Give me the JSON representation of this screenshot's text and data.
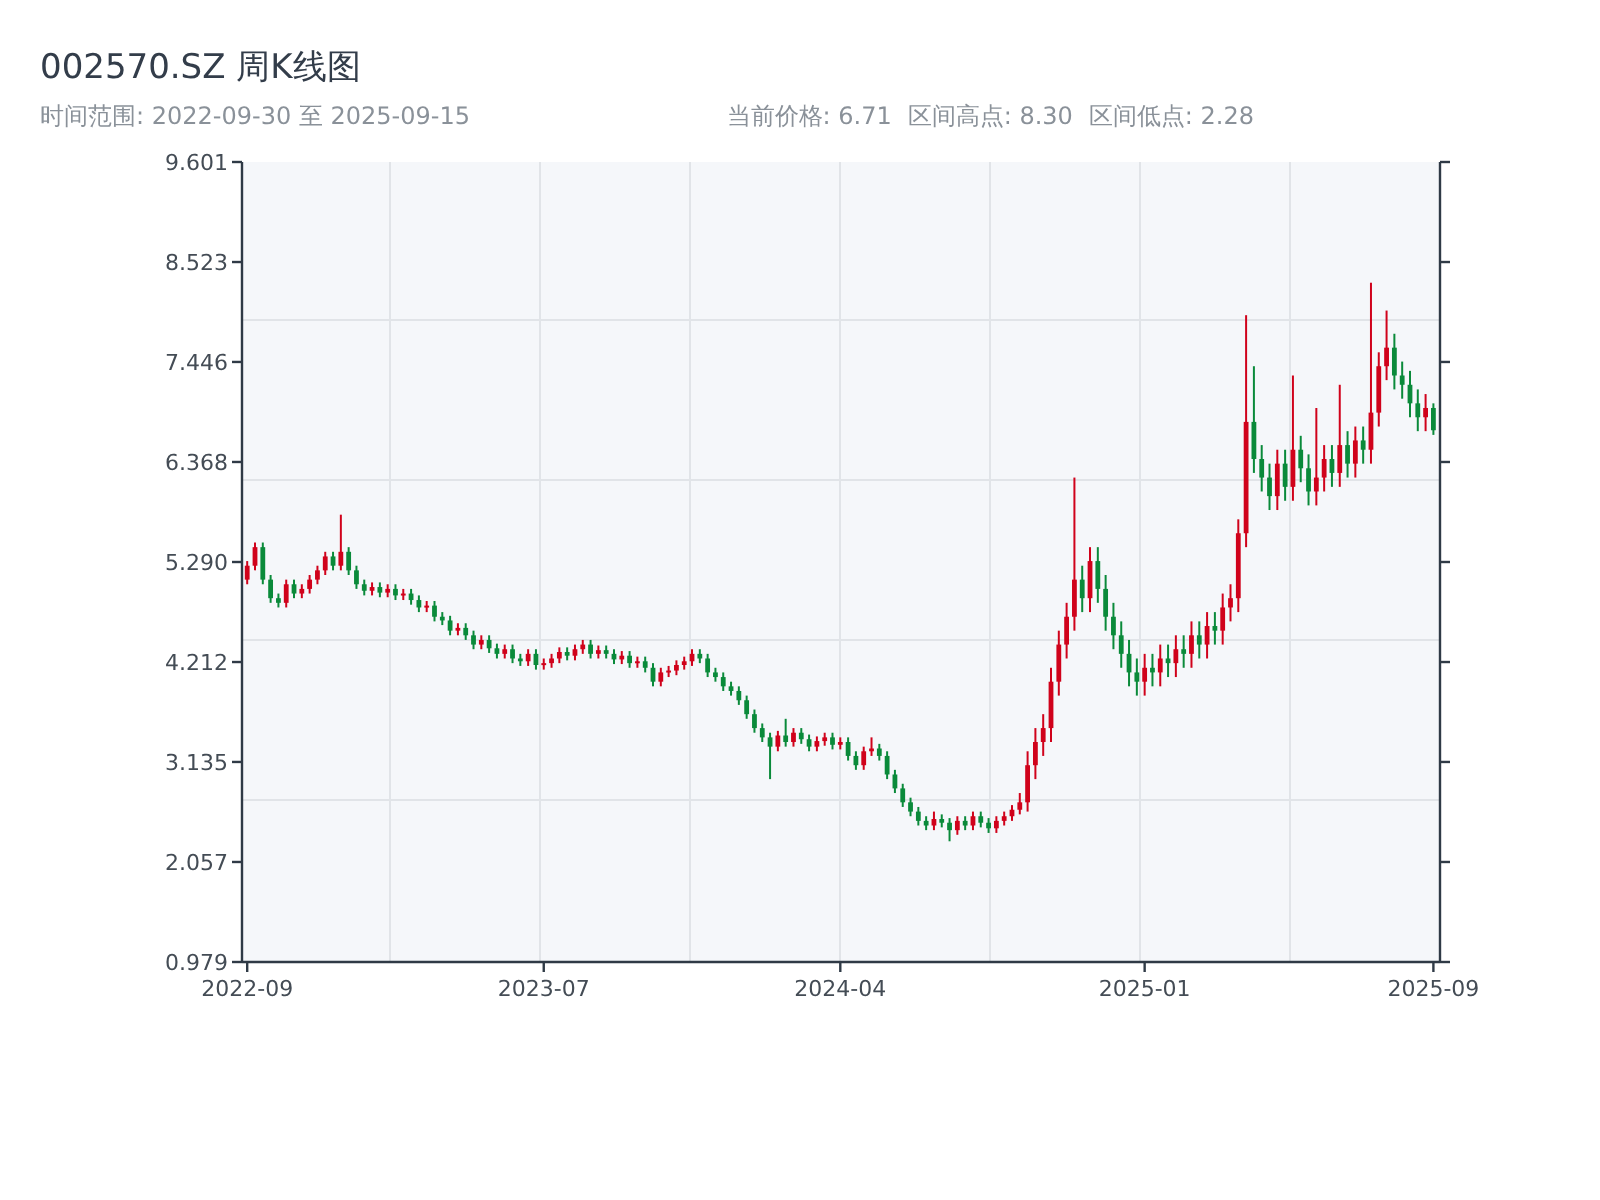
{
  "title": "002570.SZ 周K线图",
  "date_range": "时间范围: 2022-09-30 至 2025-09-15",
  "stats": [
    "当前价格: 6.71",
    "区间高点: 8.30",
    "区间低点: 2.28"
  ],
  "chart": {
    "chart_data": {
      "type": "candlestick",
      "categories": [
        "2022-09",
        null,
        null,
        null,
        null,
        null,
        null,
        null,
        null,
        null,
        null,
        null,
        null,
        null,
        null,
        null,
        null,
        null,
        null,
        null,
        null,
        null,
        null,
        null,
        null,
        null,
        null,
        null,
        null,
        null,
        null,
        null,
        null,
        null,
        null,
        null,
        null,
        null,
        "2023-07",
        null,
        null,
        null,
        null,
        null,
        null,
        null,
        null,
        null,
        null,
        null,
        null,
        null,
        null,
        null,
        null,
        null,
        null,
        null,
        null,
        null,
        null,
        null,
        null,
        null,
        null,
        null,
        null,
        null,
        null,
        null,
        null,
        null,
        null,
        null,
        null,
        null,
        "2024-04",
        null,
        null,
        null,
        null,
        null,
        null,
        null,
        null,
        null,
        null,
        null,
        null,
        null,
        null,
        null,
        null,
        null,
        null,
        null,
        null,
        null,
        null,
        null,
        null,
        null,
        null,
        null,
        null,
        null,
        null,
        null,
        null,
        null,
        null,
        null,
        null,
        null,
        null,
        "2025-01",
        null,
        null,
        null,
        null,
        null,
        null,
        null,
        null,
        null,
        null,
        null,
        null,
        null,
        null,
        null,
        null,
        null,
        null,
        null,
        null,
        null,
        null,
        null,
        null,
        null,
        null,
        null,
        null,
        null,
        null,
        null,
        null,
        null,
        null,
        null,
        null,
        "2025-09"
      ],
      "ohlc": [
        [
          5.1,
          5.3,
          5.05,
          5.25
        ],
        [
          5.25,
          5.5,
          5.2,
          5.45
        ],
        [
          5.45,
          5.5,
          5.05,
          5.1
        ],
        [
          5.1,
          5.15,
          4.85,
          4.9
        ],
        [
          4.9,
          4.95,
          4.8,
          4.85
        ],
        [
          4.85,
          5.1,
          4.8,
          5.05
        ],
        [
          5.05,
          5.1,
          4.9,
          4.95
        ],
        [
          4.95,
          5.05,
          4.9,
          5.0
        ],
        [
          5.0,
          5.15,
          4.95,
          5.1
        ],
        [
          5.1,
          5.25,
          5.05,
          5.2
        ],
        [
          5.2,
          5.4,
          5.15,
          5.35
        ],
        [
          5.35,
          5.4,
          5.2,
          5.25
        ],
        [
          5.25,
          5.8,
          5.2,
          5.4
        ],
        [
          5.4,
          5.45,
          5.15,
          5.2
        ],
        [
          5.2,
          5.25,
          5.0,
          5.05
        ],
        [
          5.05,
          5.1,
          4.93,
          4.98
        ],
        [
          4.98,
          5.07,
          4.93,
          5.02
        ],
        [
          5.02,
          5.07,
          4.91,
          4.96
        ],
        [
          4.96,
          5.05,
          4.91,
          5.0
        ],
        [
          5.0,
          5.05,
          4.88,
          4.93
        ],
        [
          4.93,
          5.0,
          4.88,
          4.95
        ],
        [
          4.95,
          5.0,
          4.83,
          4.88
        ],
        [
          4.88,
          4.93,
          4.75,
          4.8
        ],
        [
          4.8,
          4.87,
          4.75,
          4.82
        ],
        [
          4.82,
          4.87,
          4.65,
          4.7
        ],
        [
          4.7,
          4.75,
          4.61,
          4.66
        ],
        [
          4.66,
          4.71,
          4.5,
          4.55
        ],
        [
          4.55,
          4.63,
          4.5,
          4.58
        ],
        [
          4.58,
          4.63,
          4.45,
          4.5
        ],
        [
          4.5,
          4.55,
          4.35,
          4.4
        ],
        [
          4.4,
          4.5,
          4.35,
          4.45
        ],
        [
          4.45,
          4.5,
          4.31,
          4.36
        ],
        [
          4.36,
          4.41,
          4.25,
          4.3
        ],
        [
          4.3,
          4.4,
          4.25,
          4.35
        ],
        [
          4.35,
          4.4,
          4.2,
          4.25
        ],
        [
          4.25,
          4.3,
          4.17,
          4.22
        ],
        [
          4.22,
          4.35,
          4.17,
          4.3
        ],
        [
          4.3,
          4.35,
          4.13,
          4.18
        ],
        [
          4.18,
          4.25,
          4.13,
          4.2
        ],
        [
          4.2,
          4.3,
          4.15,
          4.25
        ],
        [
          4.25,
          4.37,
          4.2,
          4.32
        ],
        [
          4.32,
          4.37,
          4.23,
          4.28
        ],
        [
          4.28,
          4.4,
          4.23,
          4.35
        ],
        [
          4.35,
          4.45,
          4.3,
          4.4
        ],
        [
          4.4,
          4.45,
          4.25,
          4.3
        ],
        [
          4.3,
          4.39,
          4.25,
          4.34
        ],
        [
          4.34,
          4.39,
          4.25,
          4.3
        ],
        [
          4.3,
          4.35,
          4.19,
          4.24
        ],
        [
          4.24,
          4.33,
          4.19,
          4.28
        ],
        [
          4.28,
          4.33,
          4.15,
          4.2
        ],
        [
          4.2,
          4.27,
          4.15,
          4.22
        ],
        [
          4.22,
          4.27,
          4.1,
          4.15
        ],
        [
          4.15,
          4.2,
          3.95,
          4.0
        ],
        [
          4.0,
          4.15,
          3.95,
          4.1
        ],
        [
          4.1,
          4.17,
          4.05,
          4.12
        ],
        [
          4.12,
          4.23,
          4.07,
          4.18
        ],
        [
          4.18,
          4.27,
          4.13,
          4.22
        ],
        [
          4.22,
          4.35,
          4.17,
          4.3
        ],
        [
          4.3,
          4.35,
          4.2,
          4.25
        ],
        [
          4.25,
          4.3,
          4.05,
          4.1
        ],
        [
          4.1,
          4.15,
          4.0,
          4.05
        ],
        [
          4.05,
          4.1,
          3.9,
          3.95
        ],
        [
          3.95,
          4.0,
          3.85,
          3.9
        ],
        [
          3.9,
          3.95,
          3.75,
          3.8
        ],
        [
          3.8,
          3.85,
          3.6,
          3.65
        ],
        [
          3.65,
          3.7,
          3.45,
          3.5
        ],
        [
          3.5,
          3.55,
          3.35,
          3.4
        ],
        [
          3.4,
          3.45,
          2.95,
          3.3
        ],
        [
          3.3,
          3.47,
          3.25,
          3.42
        ],
        [
          3.42,
          3.6,
          3.3,
          3.35
        ],
        [
          3.35,
          3.5,
          3.3,
          3.45
        ],
        [
          3.45,
          3.5,
          3.33,
          3.38
        ],
        [
          3.38,
          3.43,
          3.25,
          3.3
        ],
        [
          3.3,
          3.41,
          3.25,
          3.36
        ],
        [
          3.36,
          3.45,
          3.31,
          3.4
        ],
        [
          3.4,
          3.45,
          3.27,
          3.32
        ],
        [
          3.32,
          3.4,
          3.27,
          3.35
        ],
        [
          3.35,
          3.4,
          3.15,
          3.2
        ],
        [
          3.2,
          3.25,
          3.05,
          3.1
        ],
        [
          3.1,
          3.3,
          3.05,
          3.25
        ],
        [
          3.25,
          3.4,
          3.2,
          3.28
        ],
        [
          3.28,
          3.33,
          3.15,
          3.2
        ],
        [
          3.2,
          3.25,
          2.95,
          3.0
        ],
        [
          3.0,
          3.05,
          2.8,
          2.85
        ],
        [
          2.85,
          2.9,
          2.65,
          2.7
        ],
        [
          2.7,
          2.75,
          2.55,
          2.6
        ],
        [
          2.6,
          2.65,
          2.45,
          2.5
        ],
        [
          2.5,
          2.55,
          2.4,
          2.45
        ],
        [
          2.45,
          2.6,
          2.4,
          2.52
        ],
        [
          2.52,
          2.57,
          2.43,
          2.48
        ],
        [
          2.48,
          2.53,
          2.28,
          2.4
        ],
        [
          2.4,
          2.55,
          2.35,
          2.5
        ],
        [
          2.5,
          2.55,
          2.4,
          2.45
        ],
        [
          2.45,
          2.6,
          2.4,
          2.55
        ],
        [
          2.55,
          2.6,
          2.43,
          2.48
        ],
        [
          2.48,
          2.53,
          2.37,
          2.42
        ],
        [
          2.42,
          2.55,
          2.37,
          2.5
        ],
        [
          2.5,
          2.6,
          2.45,
          2.55
        ],
        [
          2.55,
          2.67,
          2.5,
          2.62
        ],
        [
          2.62,
          2.8,
          2.57,
          2.7
        ],
        [
          2.7,
          3.25,
          2.6,
          3.1
        ],
        [
          3.1,
          3.5,
          2.95,
          3.35
        ],
        [
          3.35,
          3.65,
          3.2,
          3.5
        ],
        [
          3.5,
          4.15,
          3.35,
          4.0
        ],
        [
          4.0,
          4.55,
          3.85,
          4.4
        ],
        [
          4.4,
          4.85,
          4.25,
          4.7
        ],
        [
          4.7,
          6.2,
          4.55,
          5.1
        ],
        [
          5.1,
          5.25,
          4.75,
          4.9
        ],
        [
          4.9,
          5.45,
          4.75,
          5.3
        ],
        [
          5.3,
          5.45,
          4.85,
          5.0
        ],
        [
          5.0,
          5.15,
          4.55,
          4.7
        ],
        [
          4.7,
          4.85,
          4.35,
          4.5
        ],
        [
          4.5,
          4.65,
          4.15,
          4.3
        ],
        [
          4.3,
          4.45,
          3.95,
          4.1
        ],
        [
          4.1,
          4.25,
          3.85,
          4.0
        ],
        [
          4.0,
          4.3,
          3.85,
          4.15
        ],
        [
          4.15,
          4.3,
          3.95,
          4.1
        ],
        [
          4.1,
          4.4,
          3.95,
          4.25
        ],
        [
          4.25,
          4.4,
          4.05,
          4.2
        ],
        [
          4.2,
          4.5,
          4.05,
          4.35
        ],
        [
          4.35,
          4.5,
          4.15,
          4.3
        ],
        [
          4.3,
          4.65,
          4.15,
          4.5
        ],
        [
          4.5,
          4.65,
          4.25,
          4.4
        ],
        [
          4.4,
          4.75,
          4.25,
          4.6
        ],
        [
          4.6,
          4.75,
          4.4,
          4.55
        ],
        [
          4.55,
          4.95,
          4.4,
          4.8
        ],
        [
          4.8,
          5.05,
          4.65,
          4.9
        ],
        [
          4.9,
          5.75,
          4.75,
          5.6
        ],
        [
          5.6,
          7.95,
          5.45,
          6.8
        ],
        [
          6.8,
          7.4,
          6.25,
          6.4
        ],
        [
          6.4,
          6.55,
          6.05,
          6.2
        ],
        [
          6.2,
          6.35,
          5.85,
          6.0
        ],
        [
          6.0,
          6.5,
          5.85,
          6.35
        ],
        [
          6.35,
          6.5,
          5.95,
          6.1
        ],
        [
          6.1,
          7.3,
          5.95,
          6.5
        ],
        [
          6.5,
          6.65,
          6.15,
          6.3
        ],
        [
          6.3,
          6.45,
          5.9,
          6.05
        ],
        [
          6.05,
          6.95,
          5.9,
          6.2
        ],
        [
          6.2,
          6.55,
          6.05,
          6.4
        ],
        [
          6.4,
          6.55,
          6.1,
          6.25
        ],
        [
          6.25,
          7.2,
          6.1,
          6.55
        ],
        [
          6.55,
          6.7,
          6.2,
          6.35
        ],
        [
          6.35,
          6.75,
          6.2,
          6.6
        ],
        [
          6.6,
          6.75,
          6.35,
          6.5
        ],
        [
          6.5,
          8.3,
          6.35,
          6.9
        ],
        [
          6.9,
          7.55,
          6.75,
          7.4
        ],
        [
          7.4,
          8.0,
          7.25,
          7.6
        ],
        [
          7.6,
          7.75,
          7.15,
          7.3
        ],
        [
          7.3,
          7.45,
          7.05,
          7.2
        ],
        [
          7.2,
          7.35,
          6.85,
          7.0
        ],
        [
          7.0,
          7.15,
          6.7,
          6.85
        ],
        [
          6.85,
          7.1,
          6.7,
          6.95
        ],
        [
          6.95,
          7.0,
          6.66,
          6.71
        ]
      ],
      "ylim": [
        0.979,
        9.601
      ],
      "yticks": [
        {
          "value": 9.601,
          "label": "9.601"
        },
        {
          "value": 8.523,
          "label": "8.523"
        },
        {
          "value": 7.446,
          "label": "7.446"
        },
        {
          "value": 6.368,
          "label": "6.368"
        },
        {
          "value": 5.29,
          "label": "5.290"
        },
        {
          "value": 4.212,
          "label": "4.212"
        },
        {
          "value": 3.135,
          "label": "3.135"
        },
        {
          "value": 2.057,
          "label": "2.057"
        },
        {
          "value": 0.979,
          "label": "0.979"
        }
      ]
    }
  }
}
